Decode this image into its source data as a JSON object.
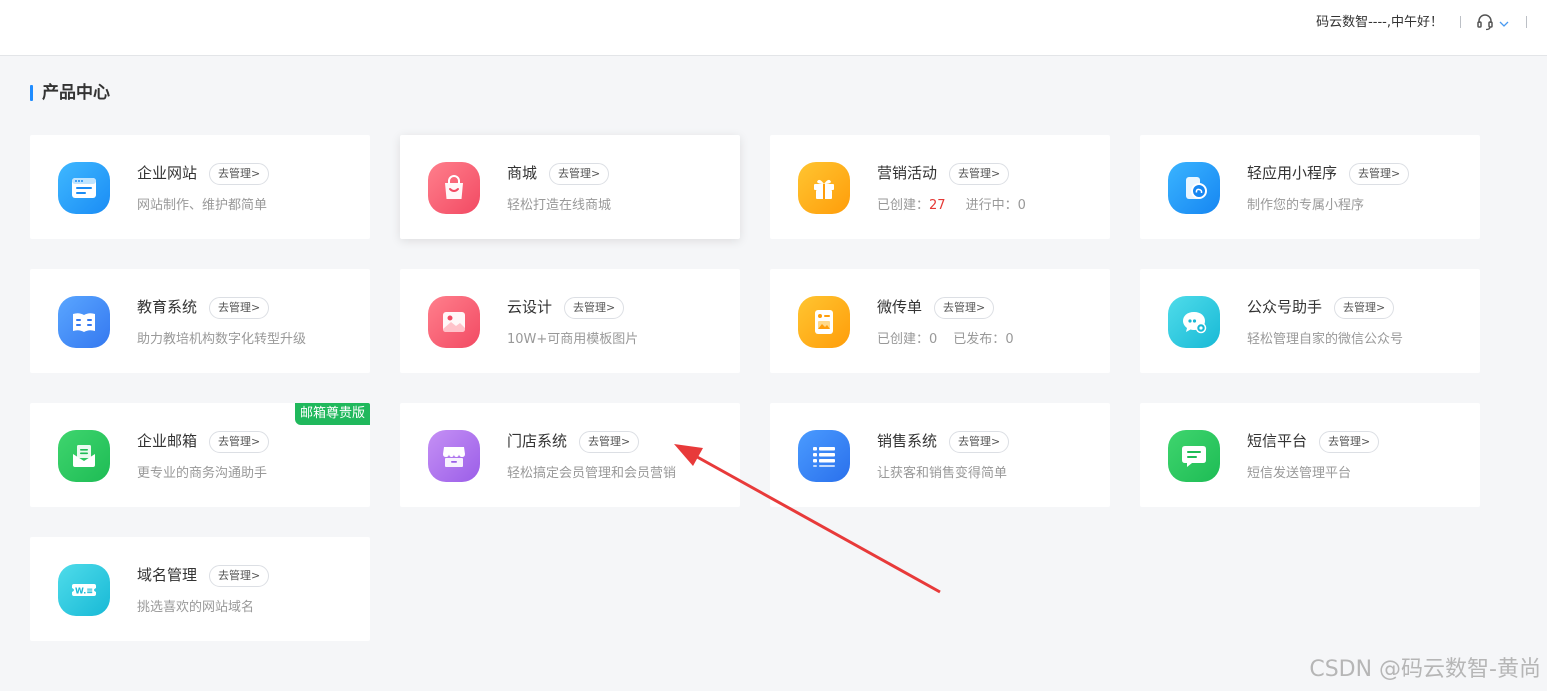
{
  "header": {
    "greeting": "码云数智----,中午好！"
  },
  "section": {
    "title": "产品中心"
  },
  "manage_label": "去管理>",
  "cards": [
    {
      "name": "企业网站",
      "desc": "网站制作、维护都简单",
      "icon": "website-icon"
    },
    {
      "name": "商城",
      "desc": "轻松打造在线商城",
      "icon": "shopping-bag-icon"
    },
    {
      "name": "营销活动",
      "stat1_label": "已创建：",
      "stat1_value": "27",
      "stat2_label": "进行中：",
      "stat2_value": "0",
      "icon": "gift-icon"
    },
    {
      "name": "轻应用小程序",
      "desc": "制作您的专属小程序",
      "icon": "mini-program-icon"
    },
    {
      "name": "教育系统",
      "desc": "助力教培机构数字化转型升级",
      "icon": "book-icon"
    },
    {
      "name": "云设计",
      "desc": "10W+可商用模板图片",
      "icon": "image-icon"
    },
    {
      "name": "微传单",
      "stat1_label": "已创建：",
      "stat1_value": "0",
      "stat2_label": "已发布：",
      "stat2_value": "0",
      "icon": "flyer-icon"
    },
    {
      "name": "公众号助手",
      "desc": "轻松管理自家的微信公众号",
      "icon": "wechat-icon"
    },
    {
      "name": "企业邮箱",
      "desc": "更专业的商务沟通助手",
      "badge": "邮箱尊贵版",
      "icon": "mail-icon"
    },
    {
      "name": "门店系统",
      "desc": "轻松搞定会员管理和会员营销",
      "icon": "store-icon"
    },
    {
      "name": "销售系统",
      "desc": "让获客和销售变得简单",
      "icon": "list-icon"
    },
    {
      "name": "短信平台",
      "desc": "短信发送管理平台",
      "icon": "sms-icon"
    },
    {
      "name": "域名管理",
      "desc": "挑选喜欢的网站域名",
      "icon": "domain-icon"
    }
  ],
  "colors": {
    "accent": "#1f8cff",
    "badge": "#20b85c",
    "arrow": "#e83a3a",
    "highlight_number": "#e53935"
  },
  "watermark": "CSDN @码云数智-黄尚"
}
